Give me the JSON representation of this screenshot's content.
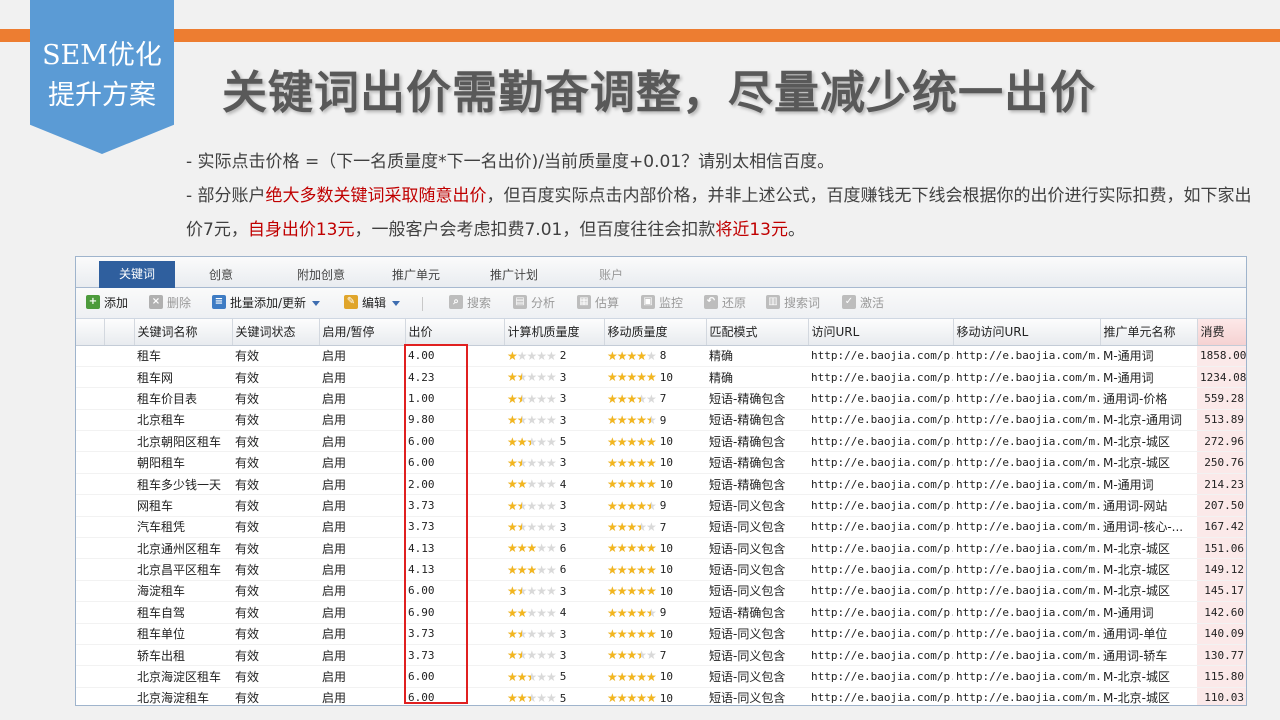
{
  "badge": {
    "line1": "SEM优化",
    "line2": "提升方案"
  },
  "title": "关键词出价需勤奋调整，尽量减少统一出价",
  "bullet1": "- 实际点击价格 =（下一名质量度*下一名出价)/当前质量度+0.01？请别太相信百度。",
  "bullet2": {
    "p1": "- 部分账户",
    "r1": "绝大多数关键词采取随意出价",
    "p2": "，但百度实际点击内部价格，并非上述公式，百度赚钱无下线会根据你的出价进行实际扣费，如下家出价7元，",
    "r2": "自身出价13元",
    "p3": "，一般客户会考虑扣费7.01，但百度往往会扣款",
    "r3": "将近13元",
    "p4": "。"
  },
  "colors": {
    "accent_orange": "#ed7d31",
    "badge_blue": "#5b9bd5",
    "highlight_red": "#c00000",
    "box_red": "#e02020",
    "star": "#f3b61f"
  },
  "tabs": [
    "关键词",
    "创意",
    "附加创意",
    "推广单元",
    "推广计划",
    "账户"
  ],
  "toolbar": {
    "add": "添加",
    "delete": "删除",
    "batch": "批量添加/更新",
    "edit": "编辑",
    "search": "搜索",
    "analyze": "分析",
    "estimate": "估算",
    "monitor": "监控",
    "restore": "还原",
    "search_term": "搜索词",
    "activate": "激活"
  },
  "columns": [
    "关键词名称",
    "关键词状态",
    "启用/暂停",
    "出价",
    "计算机质量度",
    "移动质量度",
    "匹配模式",
    "访问URL",
    "移动访问URL",
    "推广单元名称",
    "消费"
  ],
  "rows": [
    {
      "kw": "租车",
      "status": "有效",
      "enable": "启用",
      "bid": "4.00",
      "pc_q": 2,
      "m_q": 8,
      "match": "精确",
      "url": "http://e.baojia.com/p...",
      "murl": "http://e.baojia.com/m...",
      "unit": "M-通用词",
      "spend": "1858.00"
    },
    {
      "kw": "租车网",
      "status": "有效",
      "enable": "启用",
      "bid": "4.23",
      "pc_q": 3,
      "m_q": 10,
      "match": "精确",
      "url": "http://e.baojia.com/p...",
      "murl": "http://e.baojia.com/m...",
      "unit": "M-通用词",
      "spend": "1234.08"
    },
    {
      "kw": "租车价目表",
      "status": "有效",
      "enable": "启用",
      "bid": "1.00",
      "pc_q": 3,
      "m_q": 7,
      "match": "短语-精确包含",
      "url": "http://e.baojia.com/p...",
      "murl": "http://e.baojia.com/m...",
      "unit": "通用词-价格",
      "spend": "559.28"
    },
    {
      "kw": "北京租车",
      "status": "有效",
      "enable": "启用",
      "bid": "9.80",
      "pc_q": 3,
      "m_q": 9,
      "match": "短语-精确包含",
      "url": "http://e.baojia.com/p...",
      "murl": "http://e.baojia.com/m...",
      "unit": "M-北京-通用词",
      "spend": "513.89"
    },
    {
      "kw": "北京朝阳区租车",
      "status": "有效",
      "enable": "启用",
      "bid": "6.00",
      "pc_q": 5,
      "m_q": 10,
      "match": "短语-精确包含",
      "url": "http://e.baojia.com/p...",
      "murl": "http://e.baojia.com/m...",
      "unit": "M-北京-城区",
      "spend": "272.96"
    },
    {
      "kw": "朝阳租车",
      "status": "有效",
      "enable": "启用",
      "bid": "6.00",
      "pc_q": 3,
      "m_q": 10,
      "match": "短语-精确包含",
      "url": "http://e.baojia.com/p...",
      "murl": "http://e.baojia.com/m...",
      "unit": "M-北京-城区",
      "spend": "250.76"
    },
    {
      "kw": "租车多少钱一天",
      "status": "有效",
      "enable": "启用",
      "bid": "2.00",
      "pc_q": 4,
      "m_q": 10,
      "match": "短语-精确包含",
      "url": "http://e.baojia.com/p...",
      "murl": "http://e.baojia.com/m...",
      "unit": "M-通用词",
      "spend": "214.23"
    },
    {
      "kw": "网租车",
      "status": "有效",
      "enable": "启用",
      "bid": "3.73",
      "pc_q": 3,
      "m_q": 9,
      "match": "短语-同义包含",
      "url": "http://e.baojia.com/p...",
      "murl": "http://e.baojia.com/m...",
      "unit": "通用词-网站",
      "spend": "207.50"
    },
    {
      "kw": "汽车租凭",
      "status": "有效",
      "enable": "启用",
      "bid": "3.73",
      "pc_q": 3,
      "m_q": 7,
      "match": "短语-同义包含",
      "url": "http://e.baojia.com/p...",
      "murl": "http://e.baojia.com/m...",
      "unit": "通用词-核心-...",
      "spend": "167.42"
    },
    {
      "kw": "北京通州区租车",
      "status": "有效",
      "enable": "启用",
      "bid": "4.13",
      "pc_q": 6,
      "m_q": 10,
      "match": "短语-同义包含",
      "url": "http://e.baojia.com/p...",
      "murl": "http://e.baojia.com/m...",
      "unit": "M-北京-城区",
      "spend": "151.06"
    },
    {
      "kw": "北京昌平区租车",
      "status": "有效",
      "enable": "启用",
      "bid": "4.13",
      "pc_q": 6,
      "m_q": 10,
      "match": "短语-同义包含",
      "url": "http://e.baojia.com/p...",
      "murl": "http://e.baojia.com/m...",
      "unit": "M-北京-城区",
      "spend": "149.12"
    },
    {
      "kw": "海淀租车",
      "status": "有效",
      "enable": "启用",
      "bid": "6.00",
      "pc_q": 3,
      "m_q": 10,
      "match": "短语-同义包含",
      "url": "http://e.baojia.com/p...",
      "murl": "http://e.baojia.com/m...",
      "unit": "M-北京-城区",
      "spend": "145.17"
    },
    {
      "kw": "租车自驾",
      "status": "有效",
      "enable": "启用",
      "bid": "6.90",
      "pc_q": 4,
      "m_q": 9,
      "match": "短语-精确包含",
      "url": "http://e.baojia.com/p...",
      "murl": "http://e.baojia.com/m...",
      "unit": "M-通用词",
      "spend": "142.60"
    },
    {
      "kw": "租车单位",
      "status": "有效",
      "enable": "启用",
      "bid": "3.73",
      "pc_q": 3,
      "m_q": 10,
      "match": "短语-同义包含",
      "url": "http://e.baojia.com/p...",
      "murl": "http://e.baojia.com/m...",
      "unit": "通用词-单位",
      "spend": "140.09"
    },
    {
      "kw": "轿车出租",
      "status": "有效",
      "enable": "启用",
      "bid": "3.73",
      "pc_q": 3,
      "m_q": 7,
      "match": "短语-同义包含",
      "url": "http://e.baojia.com/p...",
      "murl": "http://e.baojia.com/m...",
      "unit": "通用词-轿车",
      "spend": "130.77"
    },
    {
      "kw": "北京海淀区租车",
      "status": "有效",
      "enable": "启用",
      "bid": "6.00",
      "pc_q": 5,
      "m_q": 10,
      "match": "短语-同义包含",
      "url": "http://e.baojia.com/p...",
      "murl": "http://e.baojia.com/m...",
      "unit": "M-北京-城区",
      "spend": "115.80"
    },
    {
      "kw": "北京海淀租车",
      "status": "有效",
      "enable": "启用",
      "bid": "6.00",
      "pc_q": 5,
      "m_q": 10,
      "match": "短语-同义包含",
      "url": "http://e.baojia.com/p...",
      "murl": "http://e.baojia.com/m...",
      "unit": "M-北京-城区",
      "spend": "110.03"
    }
  ]
}
